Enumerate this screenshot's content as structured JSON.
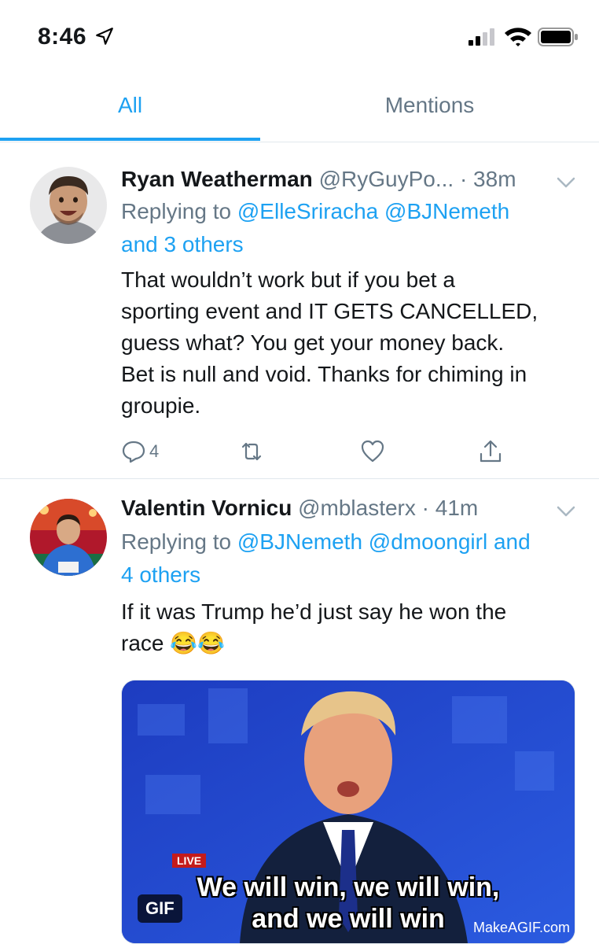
{
  "status_bar": {
    "time": "8:46",
    "icons": [
      "location-arrow-icon",
      "cellular-signal-icon",
      "wifi-icon",
      "battery-icon"
    ]
  },
  "tabs": [
    {
      "label": "All",
      "active": true
    },
    {
      "label": "Mentions",
      "active": false
    }
  ],
  "colors": {
    "accent": "#1da1f2",
    "secondary_text": "#657786",
    "primary_text": "#14171a",
    "divider": "#e1e8ed"
  },
  "tweets": [
    {
      "name": "Ryan Weatherman",
      "handle": "@RyGuyPo...",
      "time": "· 38m",
      "replying_prefix": "Replying to",
      "replying_mentions": [
        "@ElleSriracha",
        "@BJNemeth"
      ],
      "replying_others": "and 3 others",
      "text_lines": [
        "That wouldn’t work but if you bet a",
        "sporting event and IT GETS CANCELLED,",
        "guess what? You get your money back.",
        "Bet is null and void. Thanks for chiming in",
        "groupie."
      ],
      "reply_count": "4"
    },
    {
      "name": "Valentin Vornicu",
      "handle": "@mblasterx",
      "time": "· 41m",
      "replying_prefix": "Replying to",
      "replying_mentions": [
        "@BJNemeth",
        "@dmoongirl"
      ],
      "replying_others_a": "and",
      "replying_others_b": "4 others",
      "text_lines": [
        "If it was Trump he’d just say he won the",
        "race 😂😂"
      ],
      "gif": {
        "badge": "GIF",
        "caption_line1": "We will win, we will win,",
        "caption_line2": "and we will win",
        "watermark": "MakeAGIF.com",
        "live_label": "LIVE"
      }
    }
  ]
}
